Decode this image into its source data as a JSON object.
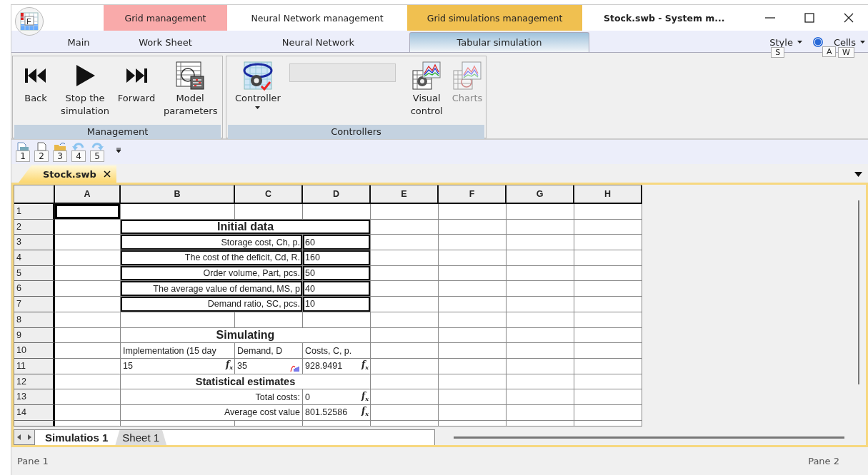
{
  "window": {
    "title": "Stock.swb - System m...",
    "app_button": "F"
  },
  "context_groups": [
    {
      "label": "Grid management",
      "color": "#f9aaaa"
    },
    {
      "label": "Neural Network management",
      "color": "#ffffff"
    },
    {
      "label": "Grid simulations management",
      "color": "#f0c050"
    }
  ],
  "ribbon_tabs": [
    {
      "label": "Main",
      "selected": false
    },
    {
      "label": "Work Sheet",
      "selected": false
    },
    {
      "label": "Neural Network",
      "selected": false
    },
    {
      "label": "Tabular simulation",
      "selected": true
    }
  ],
  "ribbon_right": {
    "style": {
      "label": "Style",
      "keytip": "S"
    },
    "help": {
      "keytip": "A"
    },
    "cells": {
      "label": "Cells",
      "keytip": "W"
    }
  },
  "ribbon_groups": [
    {
      "label": "Management",
      "buttons": [
        {
          "kind": "button",
          "label": "Back",
          "disabled": false,
          "dropdown": false
        },
        {
          "kind": "button",
          "label": "Stop the simulation",
          "disabled": false,
          "dropdown": false
        },
        {
          "kind": "button",
          "label": "Forward",
          "disabled": false,
          "dropdown": false
        },
        {
          "kind": "button",
          "label": "Model parameters",
          "disabled": false,
          "dropdown": false
        }
      ]
    },
    {
      "label": "Controllers",
      "buttons": [
        {
          "kind": "button",
          "label": "Controller",
          "disabled": false,
          "dropdown": true
        },
        {
          "kind": "field",
          "disabled": true
        },
        {
          "kind": "button",
          "label": "Visual control",
          "disabled": false,
          "dropdown": false
        },
        {
          "kind": "button",
          "label": "Charts",
          "disabled": true,
          "dropdown": false
        }
      ]
    }
  ],
  "quick_access": {
    "keytips": [
      "1",
      "2",
      "3",
      "4",
      "5"
    ]
  },
  "document_tab": {
    "label": "Stock.swb"
  },
  "sheet": {
    "columns": [
      "A",
      "B",
      "C",
      "D",
      "E",
      "F",
      "G",
      "H"
    ],
    "rows": [
      {
        "header": "1",
        "cells": [
          {
            "kind": "value",
            "selected": true
          },
          "",
          "",
          "",
          "",
          "",
          "",
          ""
        ]
      },
      {
        "header": "2",
        "cells": [
          "",
          {
            "text": "Initial data",
            "kind": "title",
            "boxed": true,
            "selected": false
          },
          "",
          "",
          "",
          "",
          "",
          ""
        ]
      },
      {
        "header": "3",
        "cells": [
          "",
          {
            "text": "Storage cost, Ch, p.",
            "kind": "label",
            "boxed": true,
            "selected": false
          },
          "",
          {
            "text": "60",
            "kind": "value",
            "boxed": true,
            "selected": false
          },
          "",
          "",
          "",
          ""
        ]
      },
      {
        "header": "4",
        "cells": [
          "",
          {
            "text": "The cost of the deficit, Cd, R.",
            "kind": "label",
            "boxed": true,
            "selected": false
          },
          "",
          {
            "text": "160",
            "kind": "value",
            "boxed": true,
            "selected": false
          },
          "",
          "",
          "",
          ""
        ]
      },
      {
        "header": "5",
        "cells": [
          "",
          {
            "text": "Order volume, Part, pcs.",
            "kind": "label",
            "boxed": true,
            "selected": false
          },
          "",
          {
            "text": "50",
            "kind": "value",
            "boxed": true,
            "selected": false
          },
          "",
          "",
          "",
          ""
        ]
      },
      {
        "header": "6",
        "cells": [
          "",
          {
            "text": "The average value of demand, MS, p",
            "kind": "label",
            "boxed": true,
            "selected": false
          },
          "",
          {
            "text": "40",
            "kind": "value",
            "boxed": true,
            "selected": false
          },
          "",
          "",
          "",
          ""
        ]
      },
      {
        "header": "7",
        "cells": [
          "",
          {
            "text": "Demand ratio, SC, pcs.",
            "kind": "label",
            "boxed": true,
            "selected": false
          },
          "",
          {
            "text": "10",
            "kind": "value",
            "boxed": true,
            "selected": false
          },
          "",
          "",
          "",
          ""
        ]
      },
      {
        "header": "8",
        "cells": [
          "",
          "",
          "",
          "",
          "",
          "",
          "",
          ""
        ]
      },
      {
        "header": "9",
        "cells": [
          "",
          {
            "text": "Simulating",
            "kind": "title",
            "boxed": false,
            "selected": false
          },
          "",
          "",
          "",
          "",
          "",
          ""
        ]
      },
      {
        "header": "10",
        "cells": [
          "",
          {
            "text": "Implementation (15 day",
            "kind": "value",
            "boxed": false,
            "selected": false
          },
          {
            "text": "Demand, D",
            "kind": "value",
            "boxed": false,
            "selected": false
          },
          {
            "text": "Costs, C, p.",
            "kind": "value",
            "boxed": false,
            "selected": false
          },
          "",
          "",
          "",
          ""
        ]
      },
      {
        "header": "11",
        "cells": [
          "",
          {
            "text": "15",
            "kind": "value",
            "boxed": false,
            "selected": false,
            "marker": "f$_{x}$"
          },
          {
            "text": "35",
            "kind": "value",
            "boxed": false,
            "selected": false,
            "distribution_icon": true
          },
          {
            "text": "928.9491",
            "kind": "value",
            "boxed": false,
            "selected": false,
            "marker": "f$_{x}$"
          },
          "",
          "",
          "",
          ""
        ]
      },
      {
        "header": "12",
        "cells": [
          "",
          {
            "text": "Statistical estimates",
            "kind": "subtitle",
            "boxed": false,
            "selected": false
          },
          "",
          "",
          "",
          "",
          "",
          ""
        ]
      },
      {
        "header": "13",
        "cells": [
          "",
          {
            "text": "Total costs:",
            "kind": "label",
            "boxed": false,
            "selected": false
          },
          "",
          {
            "text": "0",
            "kind": "value",
            "boxed": false,
            "selected": false,
            "marker": "f$_{x}$"
          },
          "",
          "",
          "",
          ""
        ]
      },
      {
        "header": "14",
        "cells": [
          "",
          {
            "text": "Average cost value",
            "kind": "label",
            "boxed": false,
            "selected": false
          },
          "",
          {
            "text": "801.52586",
            "kind": "value",
            "boxed": false,
            "selected": false,
            "marker": "f$_{x}$"
          },
          "",
          "",
          "",
          ""
        ]
      }
    ]
  },
  "sheet_tabs": [
    {
      "label": "Simulatios 1",
      "selected": true
    },
    {
      "label": "Sheet 1",
      "selected": false
    }
  ],
  "status_bar": {
    "left": "Pane 1",
    "right": "Pane 2"
  }
}
